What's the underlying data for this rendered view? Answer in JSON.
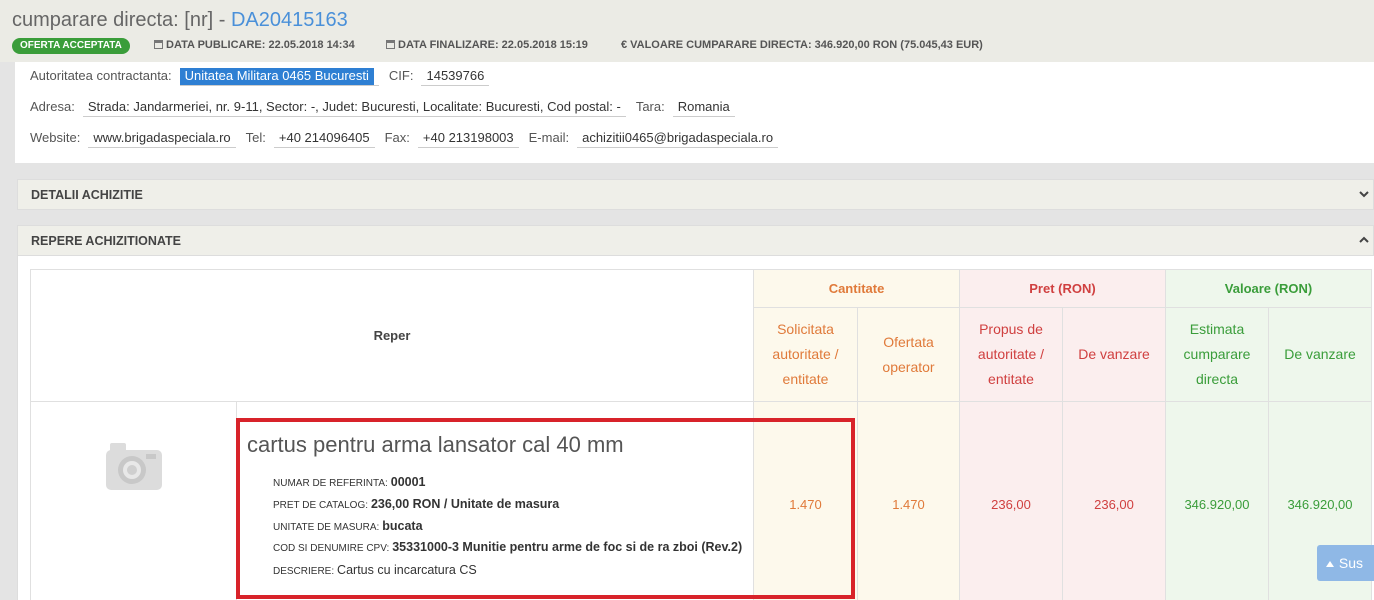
{
  "header": {
    "title_prefix": "cumparare directa: [nr] - ",
    "title_id": "DA20415163",
    "status": "OFERTA ACCEPTATA",
    "publish_date": "DATA PUBLICARE: 22.05.2018 14:34",
    "finalize_date": "DATA FINALIZARE: 22.05.2018 15:19",
    "value_text": "VALOARE CUMPARARE DIRECTA: 346.920,00  RON (75.045,43  EUR)",
    "currency_symbol": "€",
    "colors": {
      "status_badge": "#3a9d3a",
      "title_id": "#4a90d9",
      "highlight": "#d8232a"
    }
  },
  "info": {
    "authority_label": "Autoritatea contractanta:",
    "authority": "Unitatea Militara 0465 Bucuresti",
    "cif_label": "CIF:",
    "cif": "14539766",
    "address_label": "Adresa:",
    "address": "Strada: Jandarmeriei, nr. 9-11, Sector: -, Judet: Bucuresti, Localitate: Bucuresti, Cod postal: -",
    "country_label": "Tara:",
    "country": "Romania",
    "website_label": "Website:",
    "website": "www.brigadaspeciala.ro",
    "tel_label": "Tel:",
    "tel": "+40 214096405",
    "fax_label": "Fax:",
    "fax": "+40 213198003",
    "email_label": "E-mail:",
    "email": "achizitii0465@brigadaspeciala.ro"
  },
  "panels": {
    "details": "DETALII ACHIZITIE",
    "items": "REPERE ACHIZITIONATE"
  },
  "table": {
    "col_reper": "Reper",
    "group_cantitate": "Cantitate",
    "group_pret": "Pret (RON)",
    "group_valoare": "Valoare (RON)",
    "sub_solicitata": "Solicitata autoritate / entitate",
    "sub_ofertata": "Ofertata operator",
    "sub_propus": "Propus de autoritate / entitate",
    "sub_pret_vanzare": "De vanzare",
    "sub_estimata": "Estimata cumparare directa",
    "sub_val_vanzare": "De vanzare",
    "item": {
      "icon": "camera-icon",
      "name": "cartus pentru arma lansator cal 40 mm",
      "ref_label": "NUMAR DE REFERINTA:",
      "ref": "00001",
      "catalog_label": "PRET DE CATALOG:",
      "catalog": "236,00  RON / Unitate de masura",
      "unit_label": "UNITATE DE MASURA:",
      "unit": "bucata",
      "cpv_label": "COD SI DENUMIRE CPV:",
      "cpv": "35331000-3 Munitie pentru arme de foc si de ra zboi (Rev.2)",
      "desc_label": "DESCRIERE:",
      "desc": "Cartus cu incarcatura CS",
      "qty_requested": "1.470",
      "qty_offered": "1.470",
      "price_proposed": "236,00",
      "price_sale": "236,00",
      "value_estimated": "346.920,00",
      "value_sale": "346.920,00"
    }
  },
  "scroll_top_label": "Sus"
}
